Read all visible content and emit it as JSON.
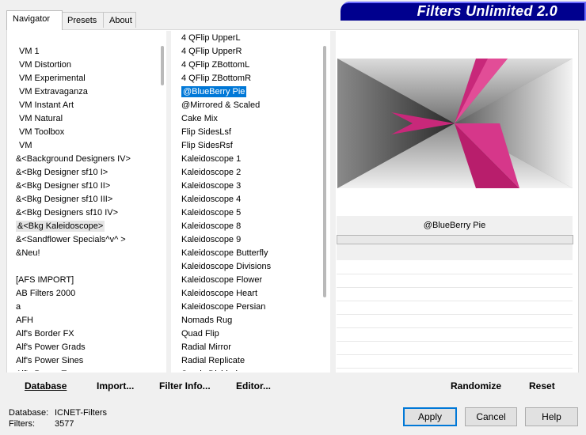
{
  "window_title": "Filters Unlimited 2.0",
  "tabs": [
    {
      "label": "Navigator"
    },
    {
      "label": "Presets"
    },
    {
      "label": "About"
    }
  ],
  "categories": [
    "VM 1",
    "VM Distortion",
    "VM Experimental",
    "VM Extravaganza",
    "VM Instant Art",
    "VM Natural",
    "VM Toolbox",
    "VM",
    "&<Background Designers IV>",
    "&<Bkg Designer sf10 I>",
    "&<Bkg Designer sf10 II>",
    "&<Bkg Designer sf10 III>",
    "&<Bkg Designers sf10 IV>",
    "&<Bkg Kaleidoscope>",
    "&<Sandflower Specials^v^ >",
    "&Neu!",
    "",
    "[AFS IMPORT]",
    "AB Filters 2000",
    "a",
    "AFH",
    "Alf's Border FX",
    "Alf's Power Grads",
    "Alf's Power Sines",
    "Alf's Power Toys"
  ],
  "category_selected_index": 13,
  "filters": [
    "4 QFlip UpperL",
    "4 QFlip UpperR",
    "4 QFlip ZBottomL",
    "4 QFlip ZBottomR",
    "@BlueBerry Pie",
    "@Mirrored & Scaled",
    "Cake Mix",
    "Flip SidesLsf",
    "Flip SidesRsf",
    "Kaleidoscope 1",
    "Kaleidoscope 2",
    "Kaleidoscope 3",
    "Kaleidoscope 4",
    "Kaleidoscope 5",
    "Kaleidoscope 8",
    "Kaleidoscope 9",
    "Kaleidoscope Butterfly",
    "Kaleidoscope Divisions",
    "Kaleidoscope Flower",
    "Kaleidoscope Heart",
    "Kaleidoscope Persian",
    "Nomads Rug",
    "Quad Flip",
    "Radial Mirror",
    "Radial Replicate",
    "Seeds Divided"
  ],
  "filter_selected_index": 4,
  "preview": {
    "filter_name": "@BlueBerry Pie",
    "accent_color": "#c8287a"
  },
  "toolbar": {
    "database": "Database",
    "import": "Import...",
    "filter_info": "Filter Info...",
    "editor": "Editor...",
    "randomize": "Randomize",
    "reset": "Reset"
  },
  "status": {
    "database_label": "Database:",
    "database_value": "ICNET-Filters",
    "filters_label": "Filters:",
    "filters_value": "3577"
  },
  "buttons": {
    "apply": "Apply",
    "cancel": "Cancel",
    "help": "Help"
  }
}
